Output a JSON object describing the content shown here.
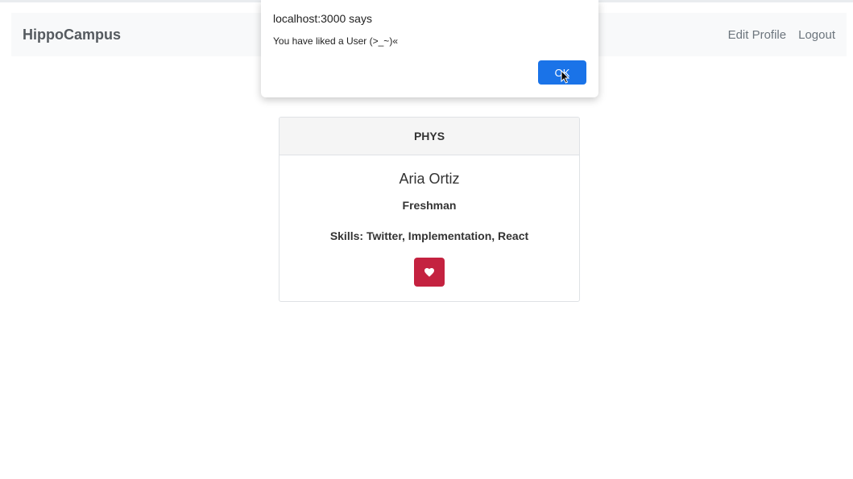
{
  "navbar": {
    "brand": "HippoCampus",
    "links": [
      "Edit Profile",
      "Logout"
    ]
  },
  "card": {
    "header": "PHYS",
    "name": "Aria Ortiz",
    "year": "Freshman",
    "skills": "Skills: Twitter, Implementation, React",
    "like_icon": "heart-icon"
  },
  "alert": {
    "title": "localhost:3000 says",
    "message": "You have liked a User (>_~)«",
    "ok_label": "OK"
  },
  "colors": {
    "like_button": "#c42240",
    "ok_button": "#1a73e8",
    "navbar_bg": "#f8f9fa"
  }
}
